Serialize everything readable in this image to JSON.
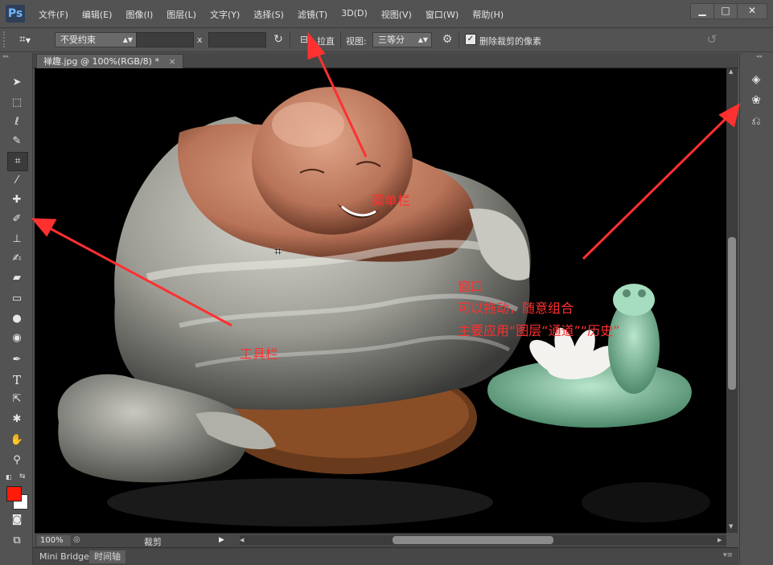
{
  "app": {
    "logo": "Ps"
  },
  "menu": [
    "文件(F)",
    "编辑(E)",
    "图像(I)",
    "图层(L)",
    "文字(Y)",
    "选择(S)",
    "滤镜(T)",
    "3D(D)",
    "视图(V)",
    "窗口(W)",
    "帮助(H)"
  ],
  "window_controls": {
    "minimize": "▁",
    "maximize": "□",
    "close": "✕"
  },
  "options": {
    "constraint": "不受约束",
    "x_label": "x",
    "straighten_label": "拉直",
    "view_label": "视图:",
    "view_value": "三等分",
    "delete_crop_label": "删除裁剪的像素",
    "delete_crop_checked": true
  },
  "document": {
    "tab_title": "禅趣.jpg @ 100%(RGB/8) *",
    "close": "×"
  },
  "status": {
    "zoom": "100%",
    "tool_name": "裁剪"
  },
  "bottom_tabs": [
    "Mini Bridge",
    "时间轴"
  ],
  "annotations": {
    "menubar": "菜单栏",
    "toolbar": "工具栏",
    "window_line1": "窗口",
    "window_line2": "可以拖动，随意组合",
    "window_line3": "主要应用“图层“通道”“历史”"
  },
  "colors": {
    "accent": "#ff3030",
    "foreground": "#ff1a0a",
    "background": "#ffffff"
  }
}
